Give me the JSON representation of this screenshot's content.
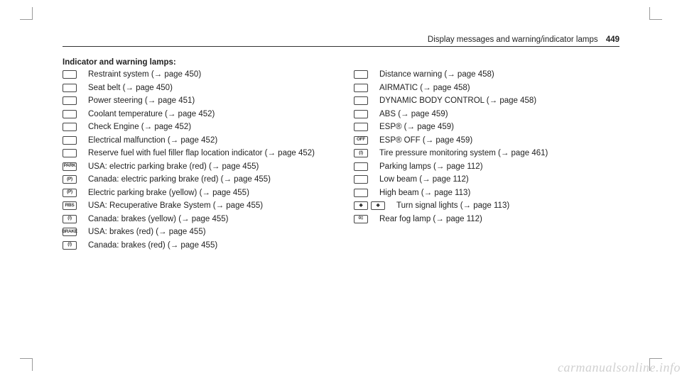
{
  "header": {
    "title": "Display messages and warning/indicator lamps",
    "pageno": "449"
  },
  "section_title": "Indicator and warning lamps:",
  "arrow": "→",
  "col1": [
    {
      "iconTxt": "",
      "text": "Restraint system (→ page 450)"
    },
    {
      "iconTxt": "",
      "text": "Seat belt (→ page 450)"
    },
    {
      "iconTxt": "",
      "text": "Power steering (→ page 451)"
    },
    {
      "iconTxt": "",
      "text": "Coolant temperature (→ page 452)"
    },
    {
      "iconTxt": "",
      "text": "Check Engine (→ page 452)"
    },
    {
      "iconTxt": "",
      "text": "Electrical malfunction (→ page 452)"
    },
    {
      "iconTxt": "",
      "text": "Reserve fuel with fuel filler flap location indicator (→ page 452)"
    },
    {
      "iconTxt": "PARK",
      "text": "USA: electric parking brake (red) (→ page 455)"
    },
    {
      "iconTxt": "(P)",
      "text": "Canada: electric parking brake (red) (→ page 455)"
    },
    {
      "iconTxt": "(P)",
      "text": "Electric parking brake (yellow) (→ page 455)"
    },
    {
      "iconTxt": "RBS",
      "text": "USA: Recuperative Brake System (→ page 455)"
    },
    {
      "iconTxt": "(!)",
      "text": "Canada: brakes (yellow) (→ page 455)"
    },
    {
      "iconTxt": "BRAKE",
      "text": "USA: brakes (red) (→ page 455)"
    },
    {
      "iconTxt": "(!)",
      "text": "Canada: brakes (red) (→ page 455)"
    }
  ],
  "col2": [
    {
      "iconTxt": "",
      "text": "Distance warning (→ page 458)"
    },
    {
      "iconTxt": "",
      "text": "AIRMATIC (→ page 458)"
    },
    {
      "iconTxt": "",
      "text": "DYNAMIC BODY CONTROL (→ page 458)"
    },
    {
      "iconTxt": "",
      "text": "ABS (→ page 459)"
    },
    {
      "iconTxt": "",
      "text": "ESP® (→ page 459)"
    },
    {
      "iconTxt": "OFF",
      "text": "ESP® OFF (→ page 459)"
    },
    {
      "iconTxt": "(!)",
      "text": "Tire pressure monitoring system (→ page 461)"
    },
    {
      "iconTxt": "",
      "text": "Parking lamps (→ page 112)"
    },
    {
      "iconTxt": "",
      "text": "Low beam (→ page 112)"
    },
    {
      "iconTxt": "",
      "text": "High beam (→ page 113)"
    },
    {
      "iconTxt": "",
      "double": true,
      "text": "Turn signal lights (→ page 113)"
    },
    {
      "iconTxt": "0‡",
      "text": "Rear fog lamp (→ page 112)"
    }
  ],
  "watermark": "carmanualsonline.info"
}
